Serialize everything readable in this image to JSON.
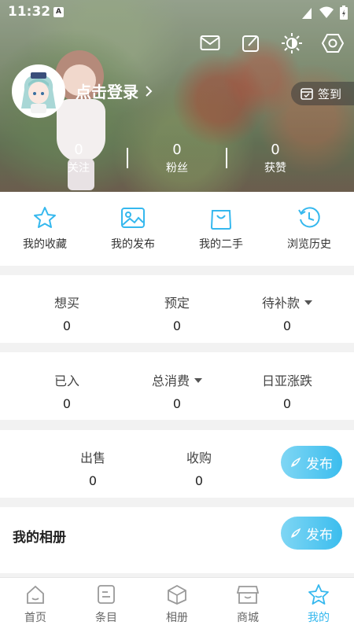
{
  "status": {
    "time": "11:32",
    "badge": "A"
  },
  "header": {
    "login_text": "点击登录",
    "checkin_label": "签到",
    "stats": [
      {
        "value": "0",
        "label": "关注"
      },
      {
        "value": "0",
        "label": "粉丝"
      },
      {
        "value": "0",
        "label": "获赞"
      }
    ]
  },
  "top_icons": [
    "mail-icon",
    "edit-icon",
    "theme-icon",
    "settings-icon"
  ],
  "quick": [
    {
      "label": "我的收藏",
      "icon": "star-icon"
    },
    {
      "label": "我的发布",
      "icon": "image-icon"
    },
    {
      "label": "我的二手",
      "icon": "bag-icon"
    },
    {
      "label": "浏览历史",
      "icon": "history-icon"
    }
  ],
  "orders": [
    {
      "label": "想买",
      "value": "0"
    },
    {
      "label": "预定",
      "value": "0"
    },
    {
      "label": "待补款",
      "value": "0"
    }
  ],
  "spend": [
    {
      "label": "已入",
      "value": "0"
    },
    {
      "label": "总消费",
      "value": "0"
    },
    {
      "label": "日亚涨跌",
      "value": "0"
    }
  ],
  "trade": [
    {
      "label": "出售",
      "value": "0"
    },
    {
      "label": "收购",
      "value": "0"
    }
  ],
  "publish_label": "发布",
  "album": {
    "title": "我的相册",
    "publish_label": "发布"
  },
  "nav": [
    {
      "label": "首页",
      "icon": "home-icon"
    },
    {
      "label": "条目",
      "icon": "list-icon"
    },
    {
      "label": "相册",
      "icon": "album-icon"
    },
    {
      "label": "商城",
      "icon": "store-icon"
    },
    {
      "label": "我的",
      "icon": "profile-star-icon"
    }
  ],
  "colors": {
    "accent": "#35b8ee",
    "active_nav": "#35b8ee"
  }
}
